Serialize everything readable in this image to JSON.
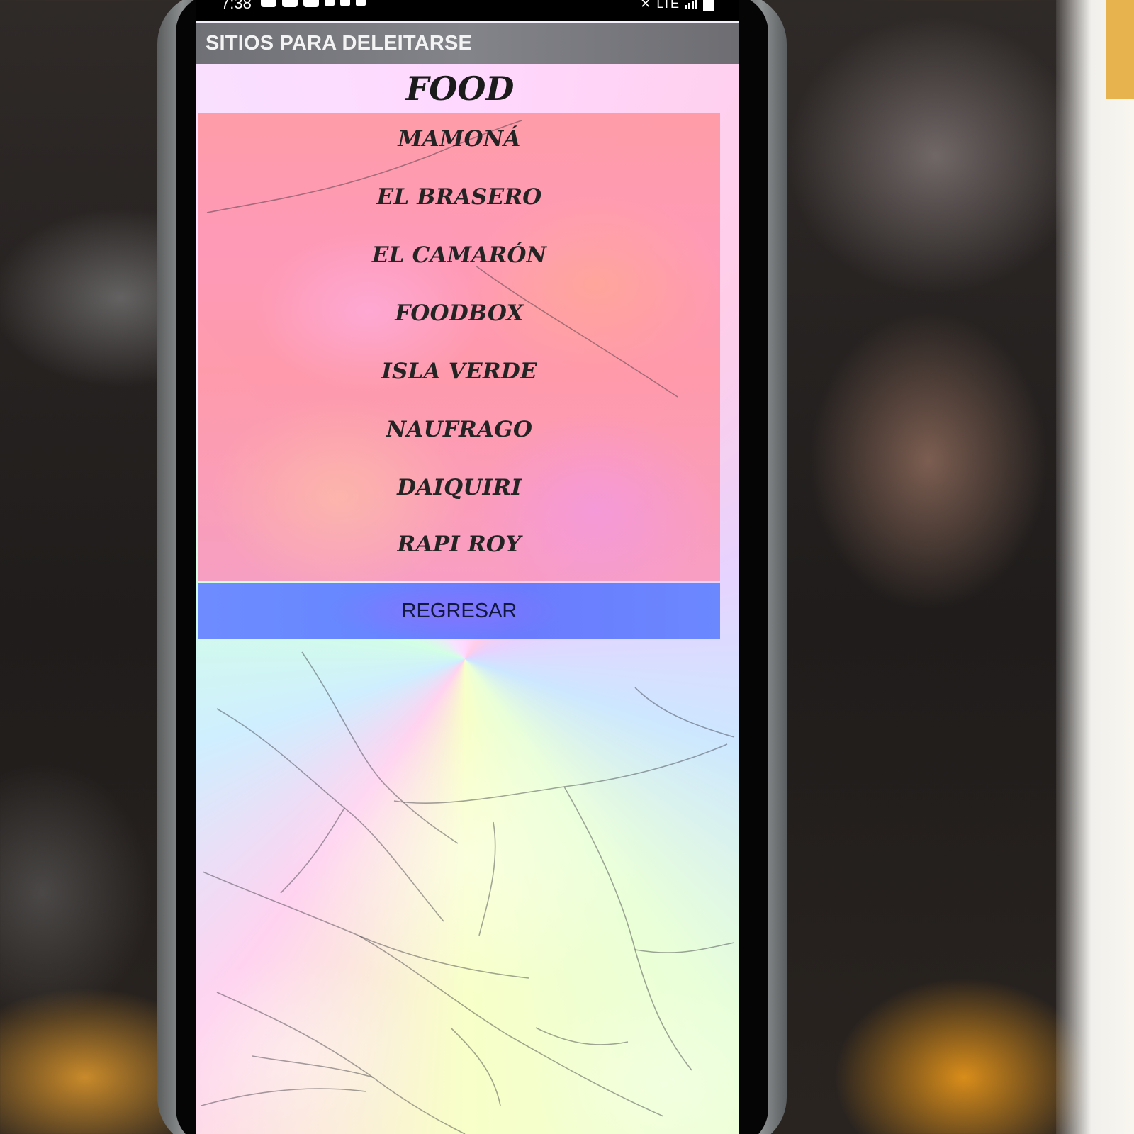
{
  "status_bar": {
    "time": "7:38",
    "network": "LTE"
  },
  "app_bar": {
    "title": "SITIOS PARA DELEITARSE"
  },
  "page": {
    "title": "FOOD"
  },
  "menu": {
    "items": [
      {
        "label": "MAMONÁ"
      },
      {
        "label": "EL BRASERO"
      },
      {
        "label": "EL CAMARÓN"
      },
      {
        "label": "FOODBOX"
      },
      {
        "label": "ISLA VERDE"
      },
      {
        "label": "NAUFRAGO"
      },
      {
        "label": "DAIQUIRI"
      },
      {
        "label": "RAPI ROY"
      }
    ]
  },
  "actions": {
    "back_label": "REGRESAR"
  },
  "colors": {
    "app_bar": "#7b7c82",
    "menu_panel": "#ff98b0",
    "back_button": "#6b85ff"
  },
  "icons": {
    "status_left": [
      "instagram-icon",
      "youtube-icon",
      "youtube-icon",
      "antenna-icon",
      "alert-icon",
      "google-icon"
    ],
    "status_right": [
      "mute-icon",
      "signal-icon",
      "battery-icon"
    ]
  }
}
